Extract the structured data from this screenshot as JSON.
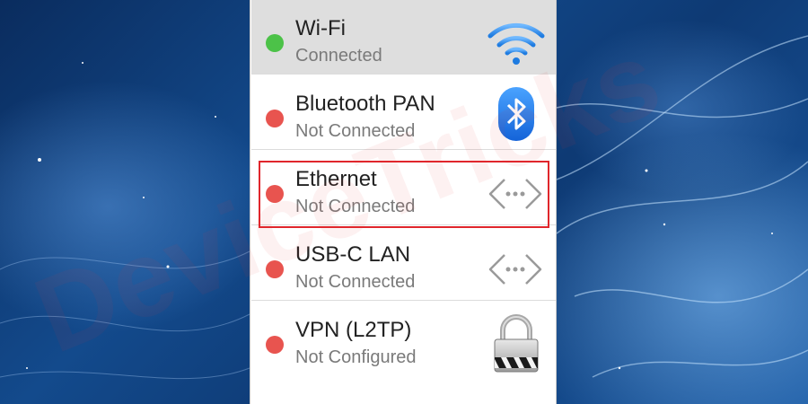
{
  "networks": [
    {
      "name": "Wi-Fi",
      "status": "Connected",
      "dot_color": "#4cc248",
      "icon": "wifi-icon",
      "selected": true
    },
    {
      "name": "Bluetooth PAN",
      "status": "Not Connected",
      "dot_color": "#e8544f",
      "icon": "bluetooth-icon",
      "selected": false
    },
    {
      "name": "Ethernet",
      "status": "Not Connected",
      "dot_color": "#e8544f",
      "icon": "ethernet-icon",
      "selected": false,
      "highlighted": true
    },
    {
      "name": "USB-C LAN",
      "status": "Not Connected",
      "dot_color": "#e8544f",
      "icon": "ethernet-icon",
      "selected": false
    },
    {
      "name": "VPN (L2TP)",
      "status": "Not Configured",
      "dot_color": "#e8544f",
      "icon": "lock-icon",
      "selected": false
    }
  ],
  "watermark": "DeviceTricks",
  "highlight_color": "#e0262c"
}
